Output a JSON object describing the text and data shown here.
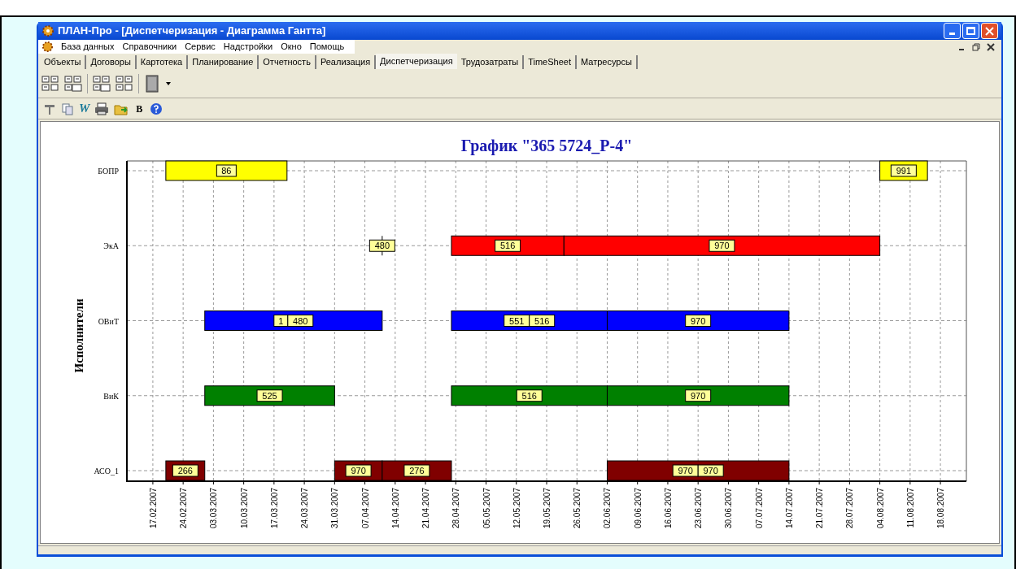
{
  "window": {
    "title": "ПЛАН-Про - [Диспетчеризация - Диаграмма Гантта]"
  },
  "menu": [
    "База данных",
    "Справочники",
    "Сервис",
    "Надстройки",
    "Окно",
    "Помощь"
  ],
  "tabs": [
    {
      "label": "Объекты",
      "selected": false
    },
    {
      "label": "Договоры",
      "selected": false
    },
    {
      "label": "Картотека",
      "selected": false
    },
    {
      "label": "Планирование",
      "selected": false
    },
    {
      "label": "Отчетность",
      "selected": false
    },
    {
      "label": "Реализация",
      "selected": false
    },
    {
      "label": "Диспетчеризация",
      "selected": true
    },
    {
      "label": "Трудозатраты",
      "selected": false
    },
    {
      "label": "TimeSheet",
      "selected": false
    },
    {
      "label": "Матресурсы",
      "selected": false
    }
  ],
  "toolbar_letters": [
    "W",
    "B"
  ],
  "gantt": {
    "title": "График \"365 5724_Р-4\"",
    "ylabel": "Исполнители",
    "date_ticks": [
      "17.02.2007",
      "24.02.2007",
      "03.03.2007",
      "10.03.2007",
      "17.03.2007",
      "24.03.2007",
      "31.03.2007",
      "07.04.2007",
      "14.04.2007",
      "21.04.2007",
      "28.04.2007",
      "05.05.2007",
      "12.05.2007",
      "19.05.2007",
      "26.05.2007",
      "02.06.2007",
      "09.06.2007",
      "16.06.2007",
      "23.06.2007",
      "30.06.2007",
      "07.07.2007",
      "14.07.2007",
      "21.07.2007",
      "28.07.2007",
      "04.08.2007",
      "11.08.2007",
      "18.08.2007"
    ],
    "rows": [
      {
        "name": "БОПР",
        "bars": [
          {
            "color": "#ffff00",
            "labels": [
              "86"
            ]
          },
          {
            "color": "#ffff00",
            "labels": [
              "991"
            ]
          }
        ]
      },
      {
        "name": "ЭкА",
        "bars": [
          {
            "color": "#ff0000",
            "labels": [
              "516"
            ]
          },
          {
            "color": "#ff0000",
            "labels": [
              "970"
            ]
          }
        ],
        "milestones": [
          {
            "label": "480"
          }
        ]
      },
      {
        "name": "ОВиТ",
        "bars": [
          {
            "color": "#0000ff",
            "labels": [
              "1",
              "480"
            ]
          },
          {
            "color": "#0000ff",
            "labels": [
              "551",
              "516"
            ]
          },
          {
            "color": "#0000ff",
            "labels": [
              "970"
            ]
          }
        ]
      },
      {
        "name": "ВиК",
        "bars": [
          {
            "color": "#008000",
            "labels": [
              "525"
            ]
          },
          {
            "color": "#008000",
            "labels": [
              "516"
            ]
          },
          {
            "color": "#008000",
            "labels": [
              "970"
            ]
          }
        ]
      },
      {
        "name": "АСО_1",
        "bars": [
          {
            "color": "#800000",
            "labels": [
              "266"
            ]
          },
          {
            "color": "#800000",
            "labels": [
              "970"
            ]
          },
          {
            "color": "#800000",
            "labels": [
              "276"
            ]
          },
          {
            "color": "#800000",
            "labels": [
              "970",
              "970"
            ]
          }
        ]
      }
    ]
  }
}
